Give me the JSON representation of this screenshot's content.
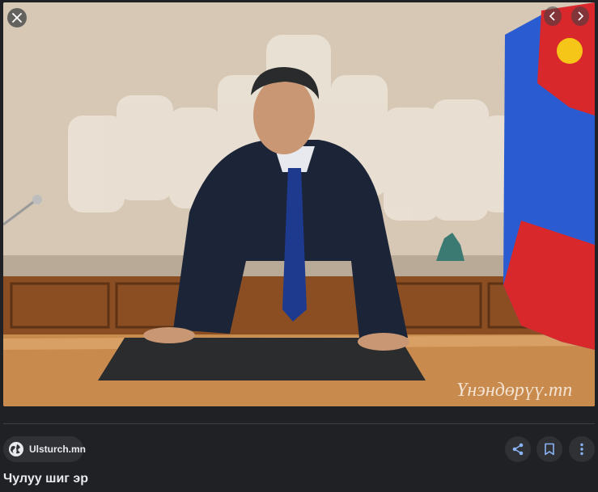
{
  "photo": {
    "watermark": "Үнэндөрүү.mn"
  },
  "source": {
    "site": "Ulsturch.mn",
    "icon": "globe-icon"
  },
  "title": "Чулуу шиг эр",
  "controls": {
    "close_icon": "close-icon",
    "prev_icon": "chevron-left-icon",
    "next_icon": "chevron-right-icon",
    "share_icon": "share-icon",
    "save_icon": "bookmark-icon",
    "more_icon": "more-vert-icon"
  },
  "colors": {
    "background": "#202124",
    "chip": "#303134",
    "accent_blue": "#8ab4f8",
    "text": "#e8eaed"
  }
}
